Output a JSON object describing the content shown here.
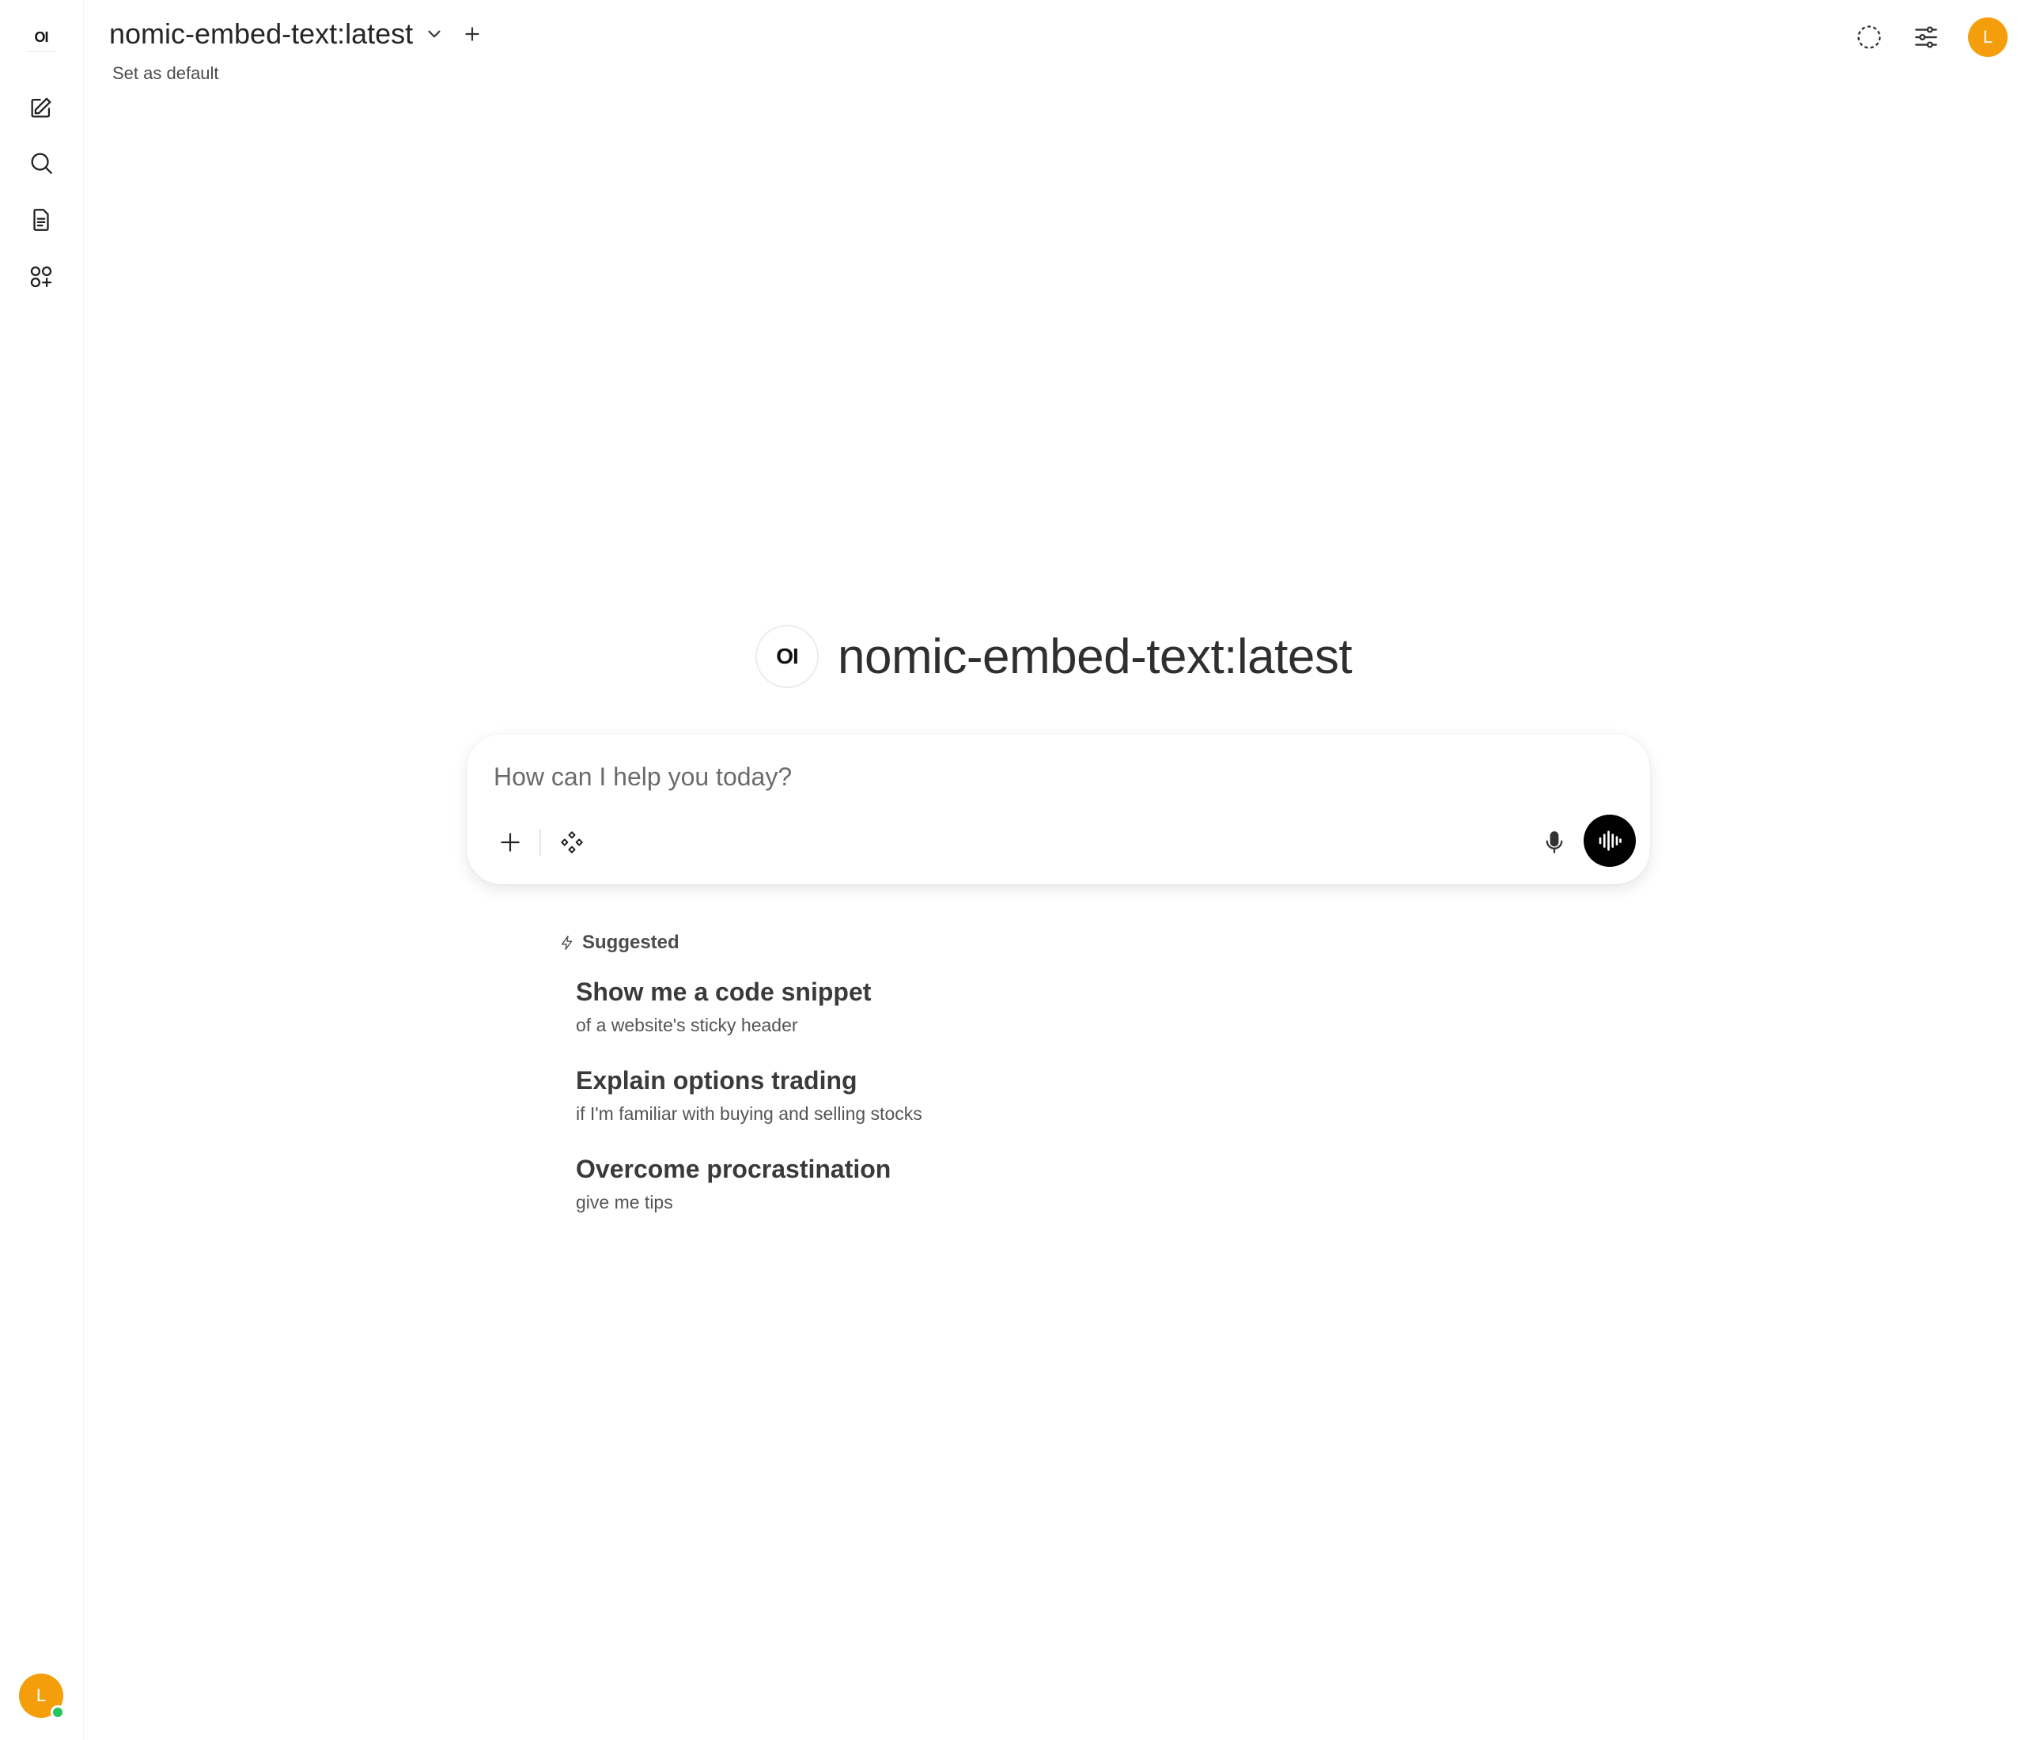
{
  "sidebar": {
    "logo_text": "OI",
    "items": [
      {
        "name": "new-chat",
        "icon": "pencil-square-icon"
      },
      {
        "name": "search",
        "icon": "search-icon"
      },
      {
        "name": "notes",
        "icon": "document-icon"
      },
      {
        "name": "workspace",
        "icon": "apps-plus-icon"
      }
    ],
    "avatar_initial": "L",
    "status": "online"
  },
  "header": {
    "model_name": "nomic-embed-text:latest",
    "set_default_label": "Set as default",
    "avatar_initial": "L"
  },
  "hero": {
    "logo_text": "OI",
    "model_name": "nomic-embed-text:latest"
  },
  "composer": {
    "placeholder": "How can I help you today?",
    "value": ""
  },
  "suggested": {
    "label": "Suggested",
    "items": [
      {
        "title": "Show me a code snippet",
        "subtitle": "of a website's sticky header"
      },
      {
        "title": "Explain options trading",
        "subtitle": "if I'm familiar with buying and selling stocks"
      },
      {
        "title": "Overcome procrastination",
        "subtitle": "give me tips"
      }
    ]
  },
  "colors": {
    "accent_avatar": "#f59e0b",
    "online": "#22c55e",
    "voice_button": "#000000"
  }
}
